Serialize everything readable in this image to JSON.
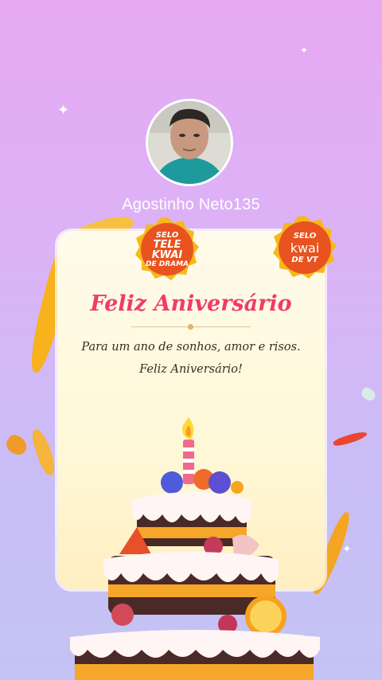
{
  "profile": {
    "username": "Agostinho Neto135"
  },
  "badges": {
    "left": {
      "line1": "SELO",
      "line2": "TELE",
      "line3": "KWAI",
      "line4": "DE DRAMA"
    },
    "right": {
      "line1": "SELO",
      "line2": "kwai",
      "line3": "DE VT"
    }
  },
  "card": {
    "title": "Feliz Aniversário",
    "message_line1": "Para um ano de sonhos, amor e risos.",
    "message_line2": "Feliz Aniversário!"
  },
  "colors": {
    "title": "#ef3b6b",
    "badge_bg": "#e8531f",
    "badge_border": "#f7b81b"
  }
}
